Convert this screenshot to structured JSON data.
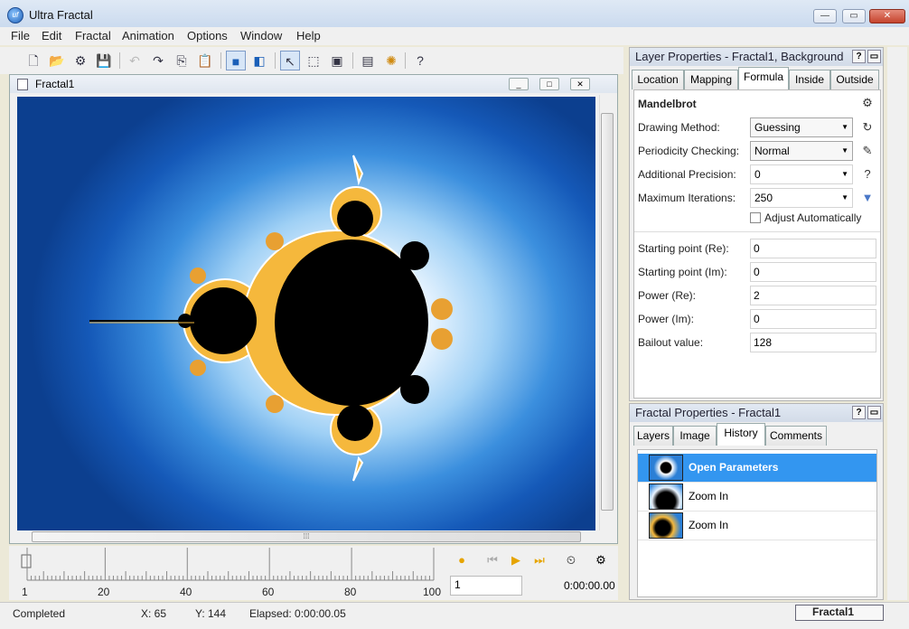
{
  "app": {
    "title": "Ultra Fractal",
    "icon": "uf-logo-icon",
    "icon_text": "uf"
  },
  "window_controls": {
    "minimize": "—",
    "maximize": "▭",
    "close": "✕"
  },
  "menu": [
    "File",
    "Edit",
    "Fractal",
    "Animation",
    "Options",
    "Window",
    "Help"
  ],
  "toolbar": {
    "icons": [
      "new-file-icon",
      "open-folder-icon",
      "open-params-icon",
      "save-icon",
      "undo-icon",
      "redo-icon",
      "copy-icon",
      "paste-icon",
      "fractal-view-icon",
      "split-view-icon",
      "select-arrow-icon",
      "zoom-box-icon",
      "window-icon",
      "render-icon",
      "settings-icon",
      "help-icon"
    ],
    "glyphs": {
      "new": "🗋",
      "open": "📂",
      "params": "⚙",
      "save": "💾",
      "undo": "↶",
      "redo": "↷",
      "copy": "⎘",
      "paste": "📋",
      "view": "■",
      "split": "◧",
      "select": "↖",
      "zoom": "⬚",
      "window": "▣",
      "render": "▤",
      "settings": "✺",
      "help": "?"
    }
  },
  "fractal_window": {
    "title": "Fractal1",
    "controls": {
      "minimize": "_",
      "maximize": "□",
      "close": "✕"
    },
    "hscroll_grip": "⁞⁞⁞"
  },
  "animation": {
    "ticks": [
      "1",
      "20",
      "40",
      "60",
      "80",
      "100"
    ],
    "frame_value": "1",
    "time": "0:00:00.00",
    "buttons": {
      "record": "●",
      "prev": "⏮",
      "play": "▶",
      "next": "⏭",
      "timer": "⏲",
      "settings": "⚙"
    }
  },
  "status": {
    "state": "Completed",
    "x": "X: 65",
    "y": "Y: 144",
    "elapsed": "Elapsed: 0:00:00.05",
    "document": "Fractal1"
  },
  "layer_panel": {
    "title": "Layer Properties - Fractal1, Background",
    "help": "?",
    "pin": "▭",
    "tabs": [
      "Location",
      "Mapping",
      "Formula",
      "Inside",
      "Outside"
    ],
    "active_tab": "Formula",
    "formula_name": "Mandelbrot",
    "selects": [
      {
        "label": "Drawing Method:",
        "value": "Guessing"
      },
      {
        "label": "Periodicity Checking:",
        "value": "Normal"
      },
      {
        "label": "Additional Precision:",
        "value": "0"
      },
      {
        "label": "Maximum Iterations:",
        "value": "250"
      }
    ],
    "side_glyphs": {
      "browse": "⚙",
      "refresh": "↻",
      "edit": "✎",
      "help": "?",
      "more": "▼",
      "dropdown": "▼"
    },
    "checkbox": {
      "label": "Adjust Automatically",
      "checked": false
    },
    "fields": [
      {
        "label": "Starting point (Re):",
        "value": "0"
      },
      {
        "label": "Starting point (Im):",
        "value": "0"
      },
      {
        "label": "Power (Re):",
        "value": "2"
      },
      {
        "label": "Power (Im):",
        "value": "0"
      },
      {
        "label": "Bailout value:",
        "value": "128"
      }
    ]
  },
  "fractal_props_panel": {
    "title": "Fractal Properties - Fractal1",
    "help": "?",
    "pin": "▭",
    "tabs": [
      "Layers",
      "Image",
      "History",
      "Comments"
    ],
    "active_tab": "History",
    "history": [
      {
        "label": "Open Parameters",
        "selected": true
      },
      {
        "label": "Zoom In",
        "selected": false
      },
      {
        "label": "Zoom In",
        "selected": false
      }
    ]
  },
  "colors": {
    "selection": "#3396f0",
    "fractal_blue": "#1559b8",
    "fractal_gold": "#f5b83c"
  }
}
